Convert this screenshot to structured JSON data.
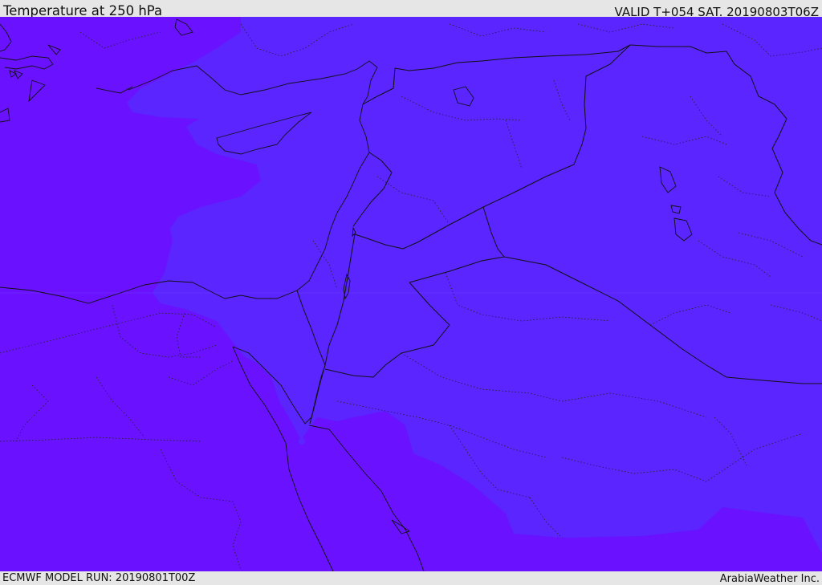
{
  "header": {
    "title": "Temperature at 250 hPa",
    "valid": "VALID T+054 SAT. 20190803T06Z"
  },
  "footer": {
    "model_run": "ECMWF MODEL RUN: 20190801T00Z",
    "credit": "ArabiaWeather Inc."
  },
  "map": {
    "colors": {
      "warm_field": "#6a12ff",
      "cool_field": "#5a25ff",
      "lines": "#111111"
    }
  }
}
